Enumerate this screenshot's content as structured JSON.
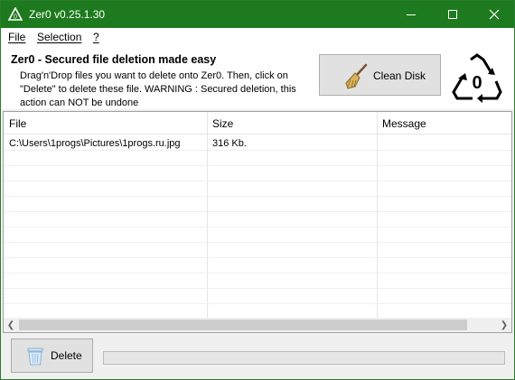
{
  "window": {
    "title": "Zer0 v0.25.1.30"
  },
  "menu": {
    "file": "File",
    "selection": "Selection",
    "help": "?"
  },
  "header": {
    "title": "Zer0 - Secured file deletion made easy",
    "description_lines": [
      "Drag'n'Drop files you want to delete onto Zer0. Then, click on",
      "\"Delete\" to delete these file. WARNING : Secured deletion, this",
      "action can NOT be undone"
    ]
  },
  "clean_button": {
    "label": "Clean Disk",
    "icon": "broom-icon"
  },
  "logo": {
    "text": "0"
  },
  "table": {
    "columns": [
      "File",
      "Size",
      "Message"
    ],
    "rows": [
      {
        "file": "C:\\Users\\1progs\\Pictures\\1progs.ru.jpg",
        "size": "316 Kb.",
        "message": ""
      }
    ]
  },
  "delete_button": {
    "label": "Delete",
    "icon": "trash-icon"
  },
  "progress": {
    "value": 0
  },
  "colors": {
    "titlebar": "#1e7a1e",
    "progress_fill": "#06b025"
  }
}
